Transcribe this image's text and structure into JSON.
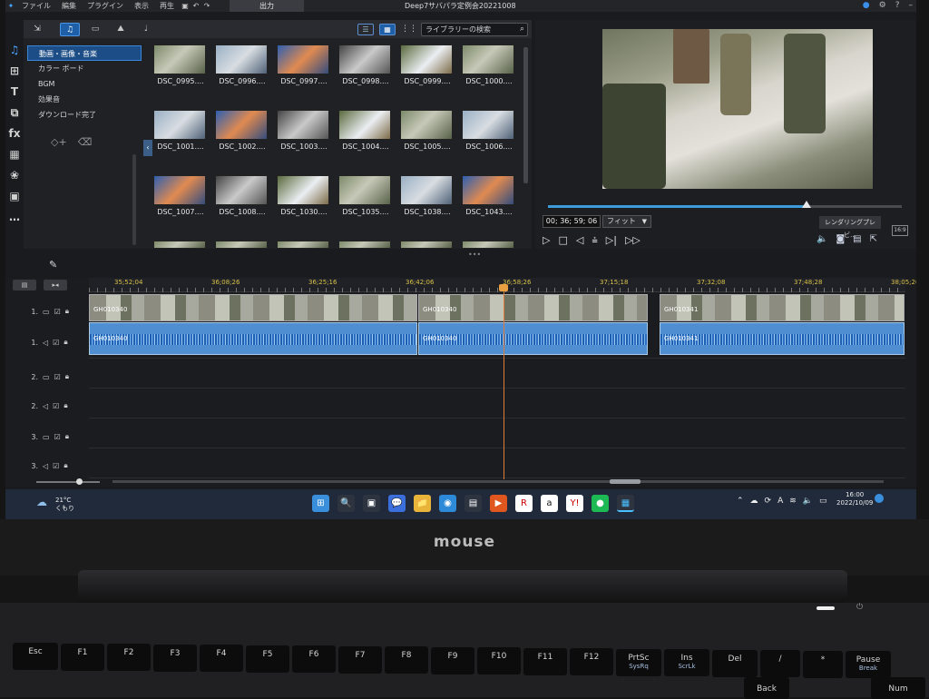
{
  "menubar": {
    "items": [
      "ファイル",
      "編集",
      "プラグイン",
      "表示",
      "再生"
    ],
    "output_tab": "出力",
    "project_title": "Deep7サバパラ定例会20221008",
    "win_controls": [
      "⚙",
      "?",
      "–"
    ]
  },
  "left_tools": [
    "♫",
    "⊞",
    "T",
    "⧉",
    "fx",
    "▦",
    "❀",
    "▣",
    "…"
  ],
  "library": {
    "tabs": [
      "♫",
      "▭",
      "⛰",
      "♩"
    ],
    "search_placeholder": "ライブラリーの検索",
    "categories": [
      "動画・画像・音楽",
      "カラー ボード",
      "BGM",
      "効果音",
      "ダウンロード完了"
    ],
    "thumbnails": [
      [
        "DSC_0995....",
        "DSC_0996....",
        "DSC_0997....",
        "DSC_0998....",
        "DSC_0999....",
        "DSC_1000...."
      ],
      [
        "DSC_1001....",
        "DSC_1002....",
        "DSC_1003....",
        "DSC_1004....",
        "DSC_1005....",
        "DSC_1006...."
      ],
      [
        "DSC_1007....",
        "DSC_1008....",
        "DSC_1030....",
        "DSC_1035....",
        "DSC_1038....",
        "DSC_1043...."
      ]
    ]
  },
  "preview": {
    "timecode": "00; 36; 59; 06",
    "fit": "フィット",
    "render_button": "レンダリングプレビ...",
    "aspect": "16:9",
    "progress": 0.73
  },
  "timeline": {
    "toolbar": [
      "▤",
      "▸◂"
    ],
    "ruler_labels": [
      "35;52;04",
      "36;08;26",
      "36;25;16",
      "36;42;06",
      "36;58;26",
      "37;15;18",
      "37;32;08",
      "37;48;28",
      "38;05;20"
    ],
    "tracks": [
      "1.",
      "1.",
      "2.",
      "2.",
      "3.",
      "3."
    ],
    "clips": {
      "v1": [
        "GH010340",
        "GH010340",
        "GH010341"
      ],
      "a1": [
        "GH010340",
        "GH010340",
        "GH010341"
      ]
    }
  },
  "taskbar": {
    "temp": "21°C",
    "weather": "くもり",
    "time": "16:00",
    "date": "2022/10/09",
    "apps": [
      "⊞",
      "🔍",
      "▣",
      "💬",
      "📁",
      "◉",
      "▤",
      "▶",
      "R",
      "a",
      "Y!",
      "●",
      "▦"
    ]
  },
  "brand": "mouse",
  "keyboard": {
    "row1": [
      {
        "key": "Esc",
        "sub": ""
      },
      {
        "key": "F1",
        "sub": ""
      },
      {
        "key": "F2",
        "sub": ""
      },
      {
        "key": "F3",
        "sub": ""
      },
      {
        "key": "F4",
        "sub": ""
      },
      {
        "key": "F5",
        "sub": ""
      },
      {
        "key": "F6",
        "sub": ""
      },
      {
        "key": "F7",
        "sub": ""
      },
      {
        "key": "F8",
        "sub": ""
      },
      {
        "key": "F9",
        "sub": ""
      },
      {
        "key": "F10",
        "sub": ""
      },
      {
        "key": "F11",
        "sub": ""
      },
      {
        "key": "F12",
        "sub": ""
      },
      {
        "key": "PrtSc",
        "sub": "SysRq"
      },
      {
        "key": "Ins",
        "sub": "ScrLk"
      },
      {
        "key": "Del",
        "sub": ""
      },
      {
        "key": "/",
        "sub": ""
      },
      {
        "key": "*",
        "sub": ""
      },
      {
        "key": "Pause",
        "sub": "Break"
      }
    ],
    "row2": [
      "Back",
      "Num"
    ]
  }
}
